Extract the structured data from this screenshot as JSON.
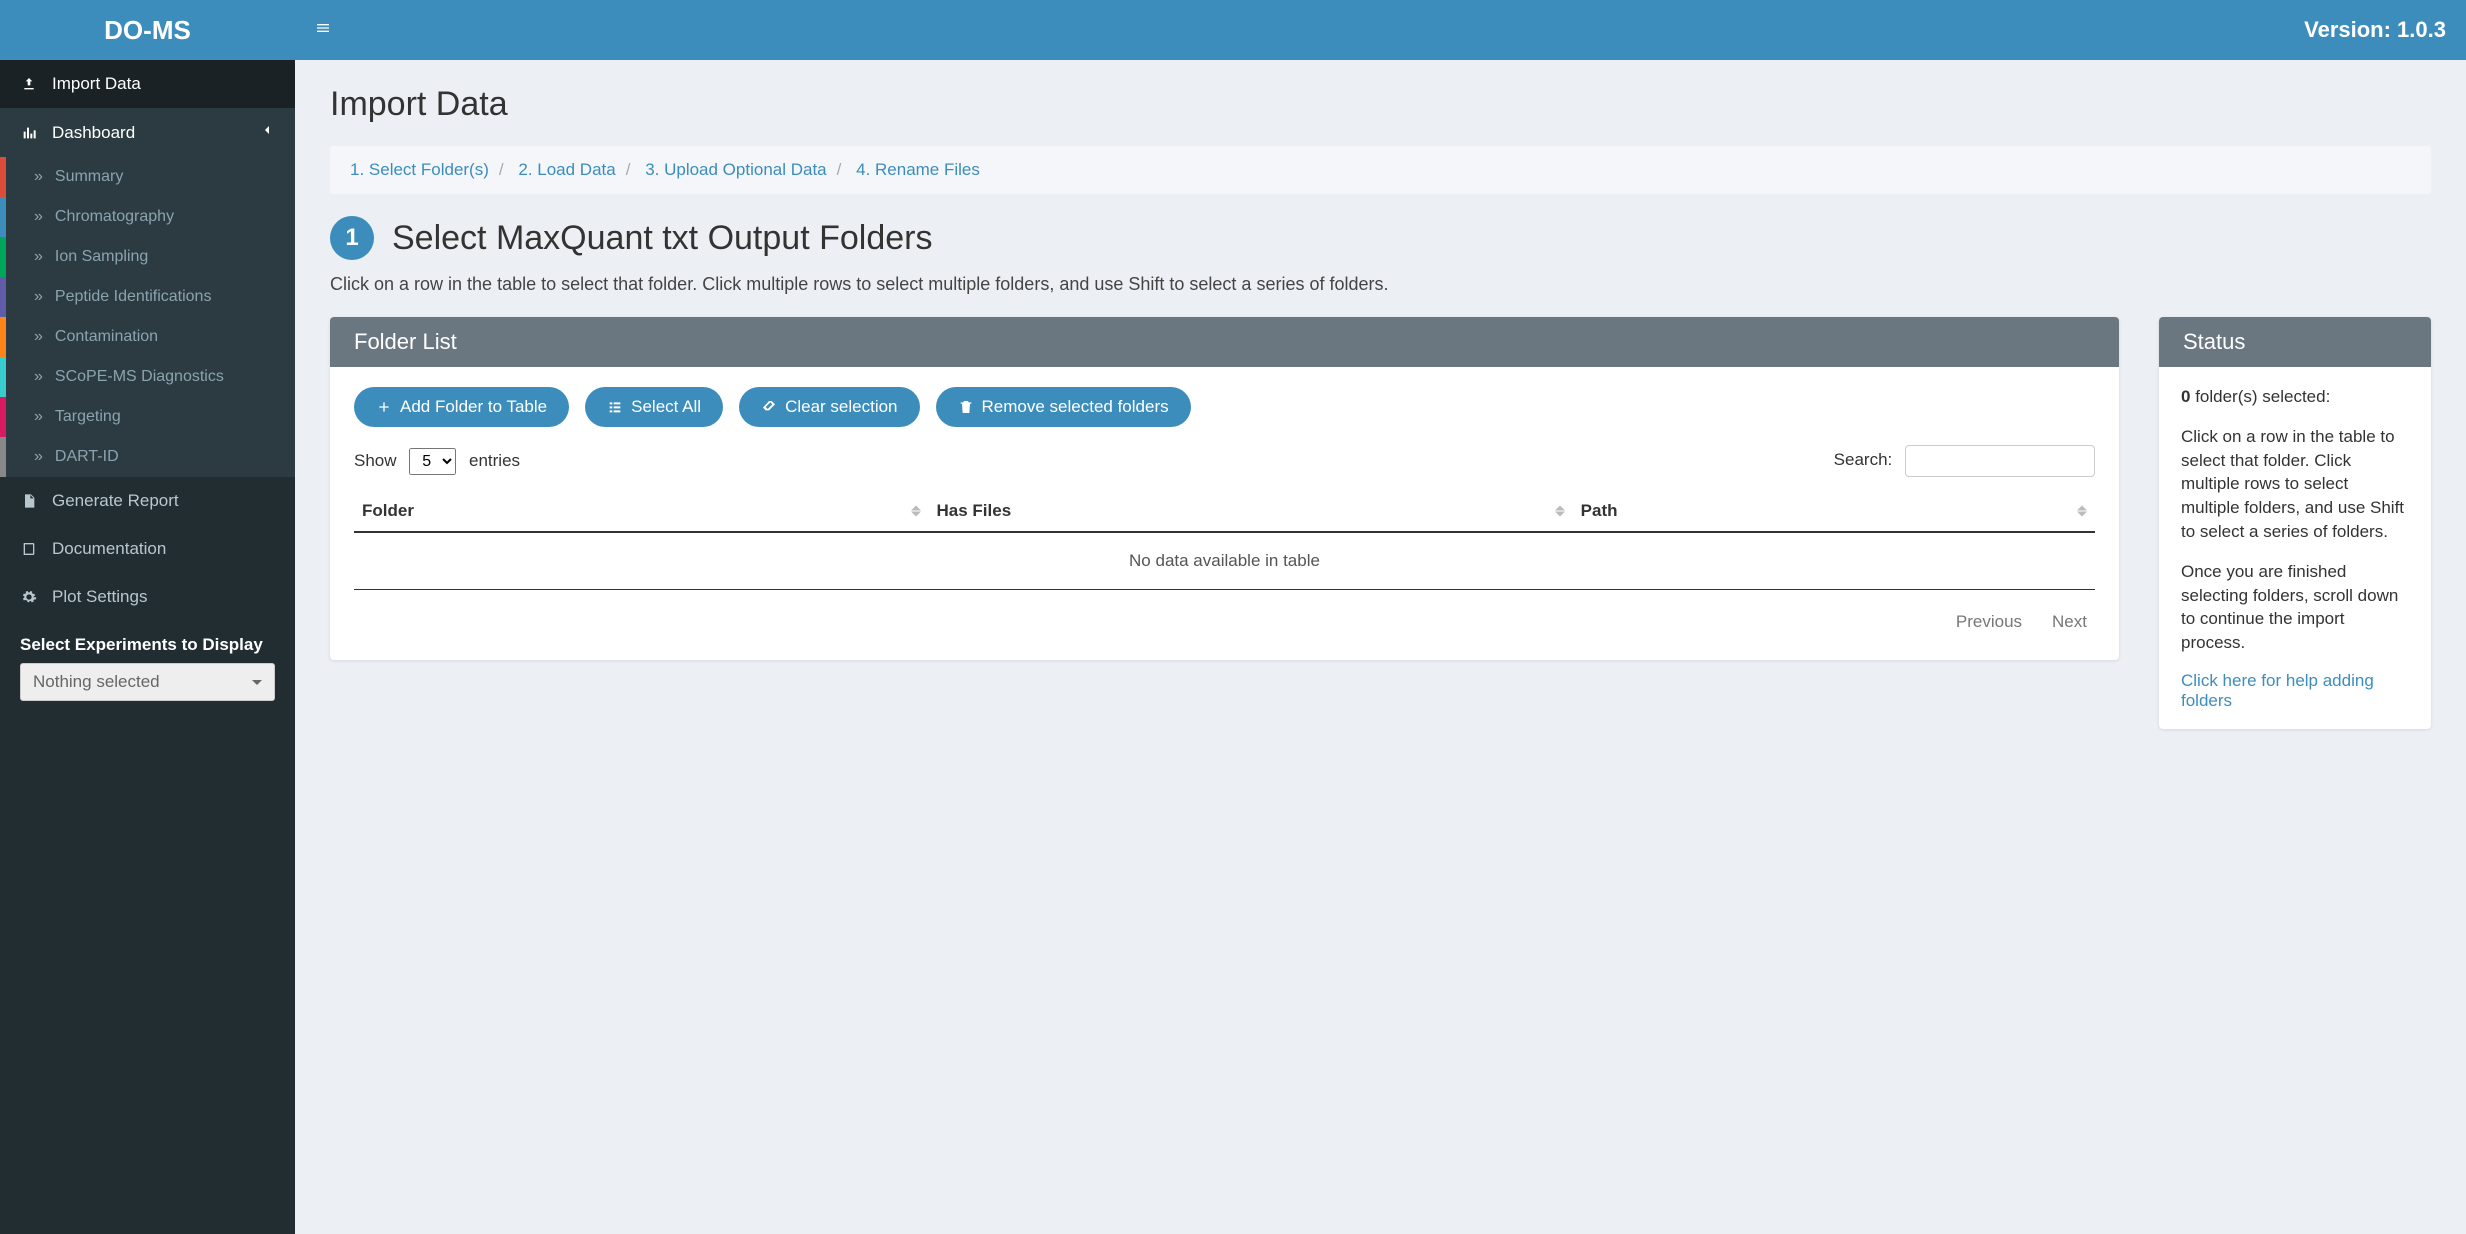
{
  "brand": "DO-MS",
  "version_label": "Version: 1.0.3",
  "sidebar": {
    "import": "Import Data",
    "dashboard": "Dashboard",
    "sub": {
      "summary": "Summary",
      "chromatography": "Chromatography",
      "ion": "Ion Sampling",
      "peptide": "Peptide Identifications",
      "contamination": "Contamination",
      "scope": "SCoPE-MS Diagnostics",
      "targeting": "Targeting",
      "dartid": "DART-ID"
    },
    "generate": "Generate Report",
    "documentation": "Documentation",
    "plot": "Plot Settings",
    "section_label": "Select Experiments to Display",
    "select_placeholder": "Nothing selected"
  },
  "page": {
    "title": "Import Data",
    "steps": {
      "s1": "1. Select Folder(s)",
      "s2": "2. Load Data",
      "s3": "3. Upload Optional Data",
      "s4": "4. Rename Files"
    },
    "section_num": "1",
    "section_title": "Select MaxQuant txt Output Folders",
    "section_desc": "Click on a row in the table to select that folder. Click multiple rows to select multiple folders, and use Shift to select a series of folders."
  },
  "folder_panel": {
    "title": "Folder List",
    "btn_add": "Add Folder to Table",
    "btn_select_all": "Select All",
    "btn_clear": "Clear selection",
    "btn_remove": "Remove selected folders",
    "show_label": "Show",
    "show_value": "5",
    "entries_label": "entries",
    "search_label": "Search:",
    "cols": {
      "folder": "Folder",
      "has_files": "Has Files",
      "path": "Path"
    },
    "empty": "No data available in table",
    "prev": "Previous",
    "next": "Next"
  },
  "status_panel": {
    "title": "Status",
    "count": "0",
    "count_suffix": " folder(s) selected:",
    "p1": "Click on a row in the table to select that folder. Click multiple rows to select multiple folders, and use Shift to select a series of folders.",
    "p2": "Once you are finished selecting folders, scroll down to continue the import process.",
    "help_link": "Click here for help adding folders"
  }
}
